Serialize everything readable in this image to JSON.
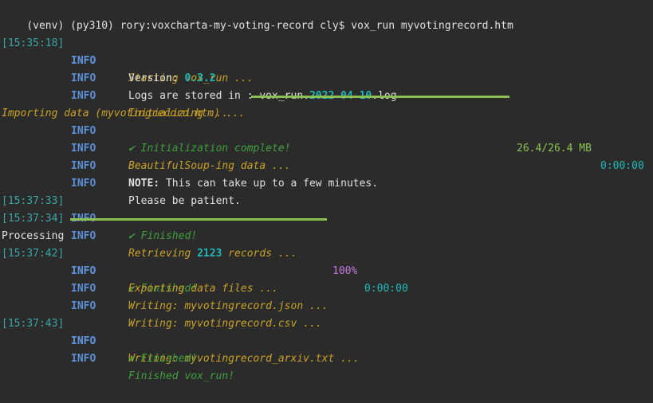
{
  "prompt": {
    "text": "(venv) (py310) rory:voxcharta-my-voting-record cly$ vox_run myvotingrecord.htm"
  },
  "lines": [
    {
      "ts": "[15:35:18]",
      "lvl": "INFO",
      "msg": "Starting vox_run ..."
    },
    {
      "lvl": "INFO",
      "msg_prefix": "Version: ",
      "msg_value": "0.3.2"
    },
    {
      "lvl": "INFO",
      "msg_prefix": "Logs are stored in : vox_run.",
      "date_parts": [
        "2022",
        "-",
        "04",
        "-",
        "10"
      ],
      "msg_suffix": ".log"
    },
    {
      "lvl": "INFO",
      "msg": "Initializing ..."
    },
    {
      "lvl": "INFO",
      "msg": "✔ Initialization complete!"
    },
    {
      "lvl": "INFO",
      "msg": "BeautifulSoup-ing data ..."
    },
    {
      "lvl": "INFO",
      "note_label": "NOTE:",
      "msg": " This can take up to a few minutes."
    },
    {
      "lvl": "INFO",
      "msg": "Please be patient."
    },
    {
      "ts": "[15:37:33]",
      "lvl": "INFO",
      "msg": "✔ Finished!"
    },
    {
      "ts": "[15:37:34]",
      "lvl": "INFO",
      "msg_prefix": "Retrieving ",
      "msg_value": "2123",
      "msg_suffix": " records ..."
    },
    {
      "ts": "[15:37:42]",
      "lvl": "INFO",
      "msg": "✔ Finished!"
    },
    {
      "lvl": "INFO",
      "msg": "Exporting data files ..."
    },
    {
      "lvl": "INFO",
      "msg": "Writing: myvotingrecord.json ..."
    },
    {
      "lvl": "INFO",
      "msg": "Writing: myvotingrecord.csv ..."
    },
    {
      "ts": "[15:37:43]",
      "lvl": "INFO",
      "msg": "Writing: myvotingrecord_arxiv.txt ..."
    },
    {
      "lvl": "INFO",
      "msg": "✔ Finished!"
    },
    {
      "lvl": "INFO",
      "msg": "Finished vox_run!"
    }
  ],
  "progress_import": {
    "label": "Importing data (myvotingrecord.htm) ...",
    "size": "26.4/26.4 MB",
    "elapsed": "0:00:00",
    "fraction": 1.0
  },
  "progress_processing": {
    "label": "Processing",
    "percent": "100%",
    "elapsed": "0:00:00",
    "fraction": 1.0
  },
  "colors": {
    "background": "#2b2b2b",
    "timestamp": "#3aa6a6",
    "info": "#5b8fd6",
    "warn_yellow": "#c9a227",
    "success_green": "#3f9f3f",
    "bar_green": "#8cc152",
    "magenta": "#c678dd"
  }
}
